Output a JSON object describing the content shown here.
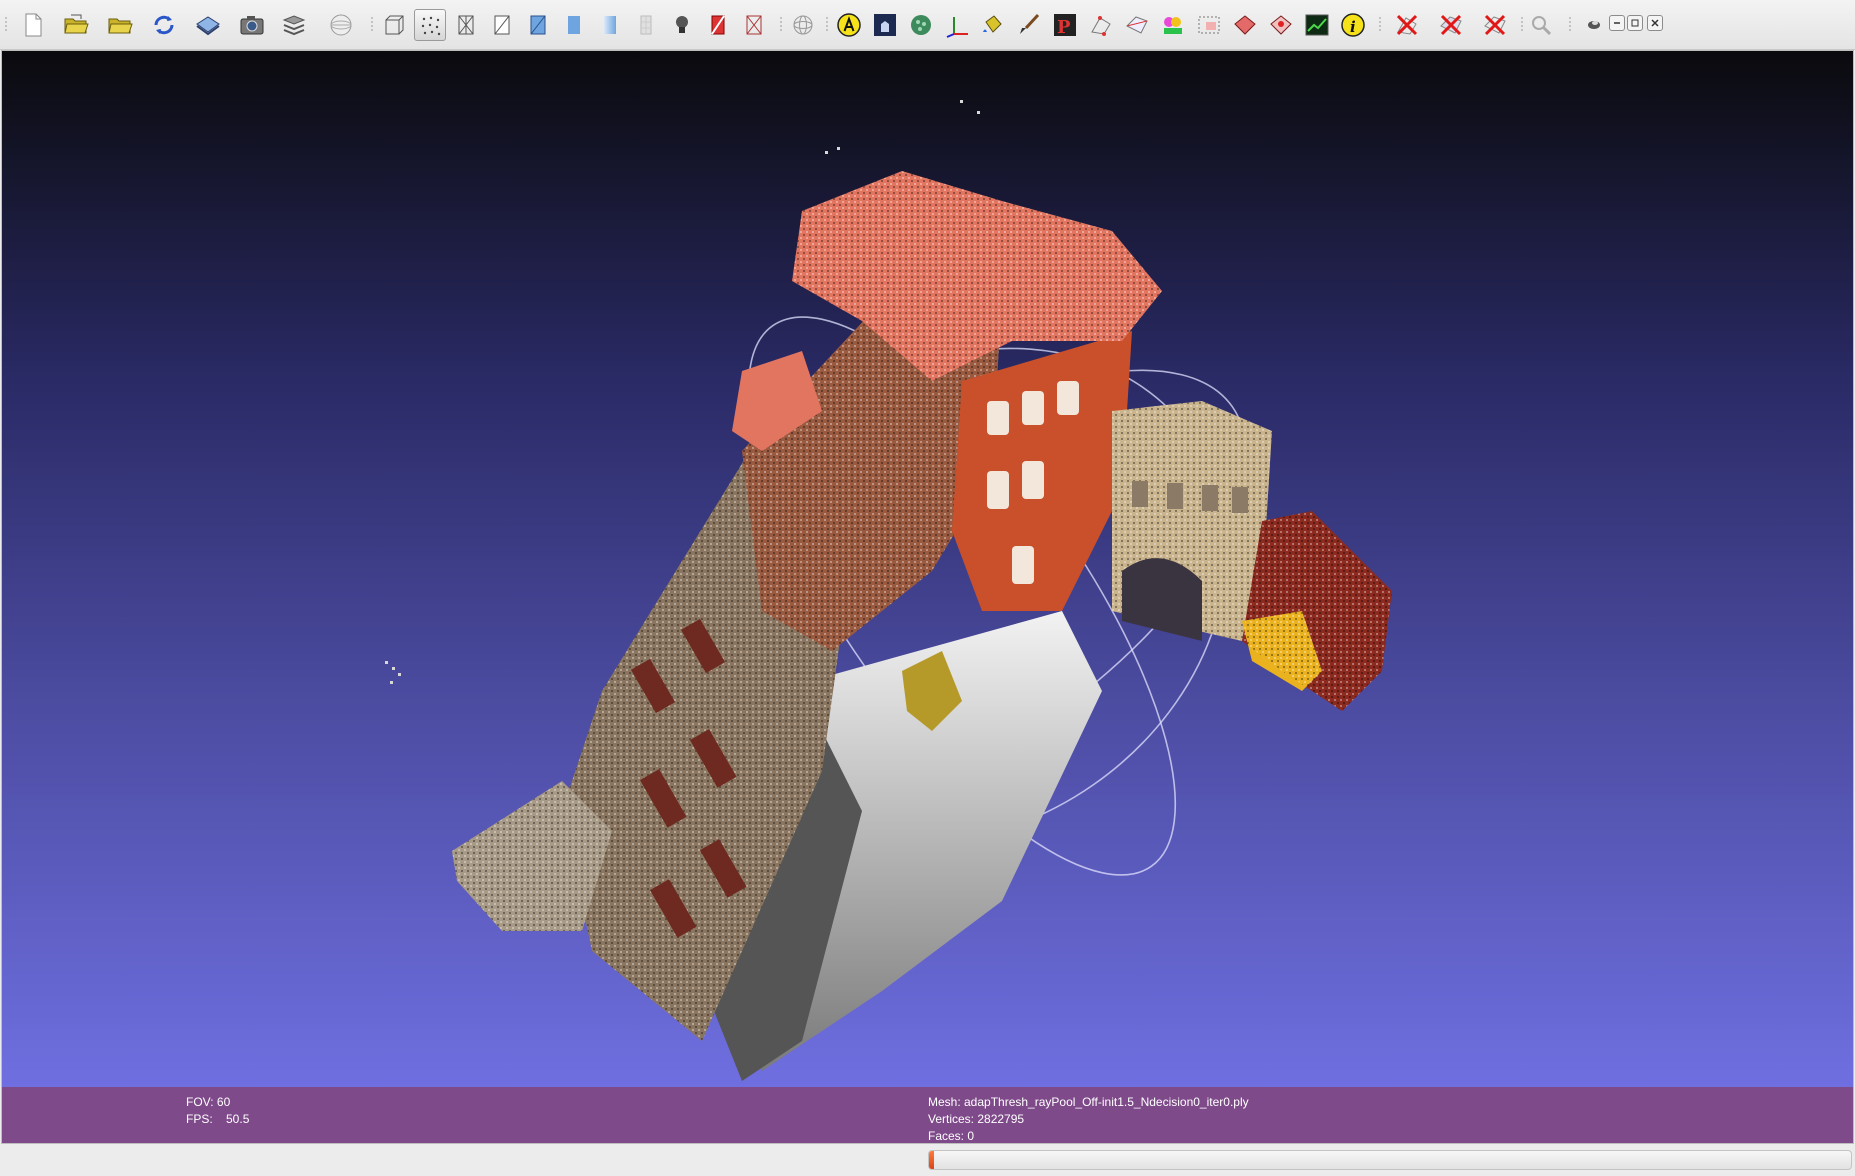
{
  "toolbar": {
    "buttons": [
      {
        "id": "new-project",
        "icon": "new-document-icon"
      },
      {
        "id": "open-project",
        "icon": "open-folder-icon"
      },
      {
        "id": "import-mesh",
        "icon": "import-folder-icon"
      },
      {
        "id": "reload",
        "icon": "reload-icon"
      },
      {
        "id": "save",
        "icon": "save-disk-icon"
      },
      {
        "id": "snapshot",
        "icon": "camera-icon"
      },
      {
        "id": "layers",
        "icon": "layers-icon"
      },
      {
        "id": "view-from",
        "icon": "view-globe-icon"
      },
      {
        "id": "render-bbox",
        "icon": "bounding-box-icon"
      },
      {
        "id": "render-points",
        "icon": "points-icon",
        "active": true
      },
      {
        "id": "render-wireframe",
        "icon": "wireframe-icon"
      },
      {
        "id": "render-hidden-lines",
        "icon": "hidden-lines-icon"
      },
      {
        "id": "render-flat-lines",
        "icon": "flat-lines-icon"
      },
      {
        "id": "render-flat",
        "icon": "flat-shading-icon"
      },
      {
        "id": "render-smooth",
        "icon": "smooth-shading-icon"
      },
      {
        "id": "texture",
        "icon": "texture-icon"
      },
      {
        "id": "lighting",
        "icon": "light-bulb-icon"
      },
      {
        "id": "backface",
        "icon": "backface-icon"
      },
      {
        "id": "fancy-light",
        "icon": "fancy-lighting-icon"
      },
      {
        "id": "trackball",
        "icon": "trackball-icon"
      },
      {
        "id": "annotation",
        "icon": "annotation-a-icon"
      },
      {
        "id": "measure",
        "icon": "render-frame-icon"
      },
      {
        "id": "shader",
        "icon": "shader-sphere-icon"
      },
      {
        "id": "axes",
        "icon": "axes-icon"
      },
      {
        "id": "paint",
        "icon": "paint-bucket-icon"
      },
      {
        "id": "brush",
        "icon": "brush-icon"
      },
      {
        "id": "pick-points",
        "icon": "pick-points-icon"
      },
      {
        "id": "select-vertices",
        "icon": "select-vertices-icon"
      },
      {
        "id": "select-connected",
        "icon": "select-connected-icon"
      },
      {
        "id": "color-select",
        "icon": "color-select-icon"
      },
      {
        "id": "select-faces",
        "icon": "select-faces-icon"
      },
      {
        "id": "select-region",
        "icon": "select-region-icon"
      },
      {
        "id": "select-paint",
        "icon": "select-paint-icon"
      },
      {
        "id": "raster",
        "icon": "raster-image-icon"
      },
      {
        "id": "info",
        "icon": "info-icon"
      },
      {
        "id": "delete-vertices",
        "icon": "delete-vertices-icon"
      },
      {
        "id": "delete-faces",
        "icon": "delete-faces-icon"
      },
      {
        "id": "delete-all",
        "icon": "delete-all-icon"
      },
      {
        "id": "search",
        "icon": "search-icon"
      }
    ],
    "window_controls": [
      "restore-down-icon",
      "minimize-icon",
      "maximize-icon",
      "close-icon"
    ]
  },
  "viewport": {
    "background_top": "#0a0a0d",
    "background_bottom": "#7474ea",
    "info_bar_color": "#7e4a8a"
  },
  "info": {
    "fov": "FOV: 60",
    "fps": "FPS:    50.5",
    "mesh": "Mesh: adapThresh_rayPool_Off-init1.5_Ndecision0_iter0.ply",
    "vertices": "Vertices: 2822795",
    "faces": "Faces: 0"
  },
  "progress": {
    "value": 0.005,
    "color": "#e8592a"
  }
}
